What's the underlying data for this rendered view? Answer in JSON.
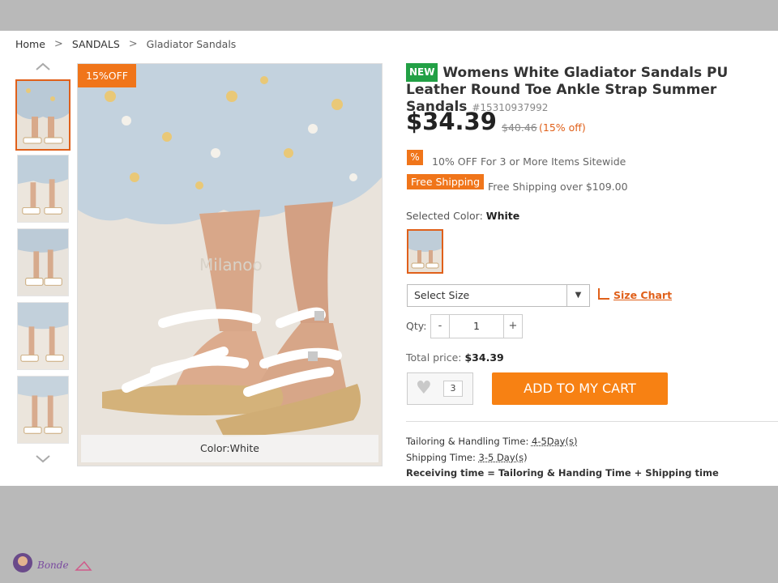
{
  "breadcrumb": [
    "Home",
    "SANDALS",
    "Gladiator Sandals"
  ],
  "breadcrumb_sep": ">",
  "thumbnails": {
    "up_icon": "chevron-up-icon",
    "down_icon": "chevron-down-icon",
    "count": 5
  },
  "main_image": {
    "discount_badge": "15%OFF",
    "caption": "Color:White",
    "watermark": "Milanoo"
  },
  "product": {
    "new_badge": "NEW",
    "title": "Womens White Gladiator Sandals PU Leather Round Toe Ankle Strap Summer Sandals",
    "sku": "#15310937992",
    "price": "$34.39",
    "old_price": "$40.46",
    "percent_off": "(15% off)"
  },
  "promos": {
    "promo1_badge": "%",
    "promo1_text": "10% OFF For 3 or More Items Sitewide",
    "shipping_badge": "Free Shipping",
    "shipping_text": "Free Shipping over $109.00"
  },
  "color": {
    "label": "Selected Color:",
    "value": "White"
  },
  "size": {
    "select_value": "Select Size",
    "chart_link": "Size Chart"
  },
  "qty": {
    "label": "Qty:",
    "minus": "-",
    "value": "1",
    "plus": "+"
  },
  "total": {
    "label": "Total price:",
    "value": "$34.39"
  },
  "wishlist": {
    "count": "3"
  },
  "cart_button": "ADD TO MY CART",
  "info": {
    "tailoring_label": "Tailoring & Handling Time:",
    "tailoring_value": "4-5Day(s)",
    "shipping_label": "Shipping Time:",
    "shipping_value": "3-5 Day(s)",
    "receiving": "Receiving time = Tailoring & Handing Time + Shipping time"
  },
  "colors": {
    "accent": "#f0751a",
    "new": "#22a045",
    "cart": "#f78113"
  }
}
